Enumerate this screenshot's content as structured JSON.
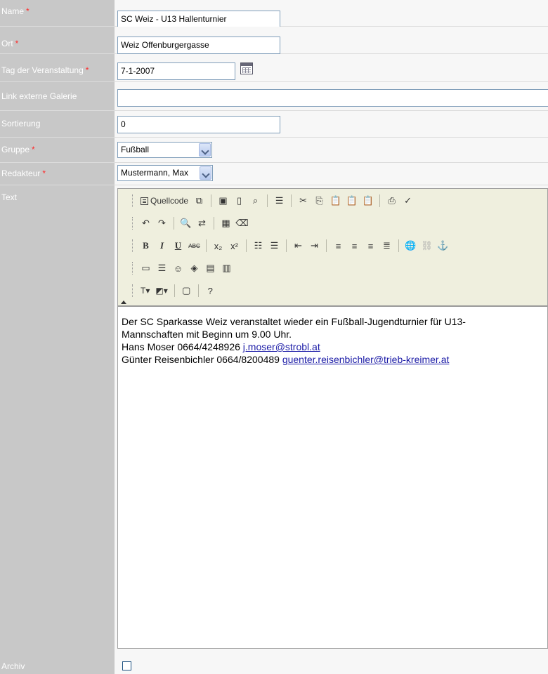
{
  "form": {
    "name": {
      "label": "Name",
      "required": "*",
      "value": "SC Weiz - U13 Hallenturnier"
    },
    "ort": {
      "label": "Ort",
      "required": "*",
      "value": "Weiz Offenburgergasse"
    },
    "tag": {
      "label": "Tag der Veranstaltung",
      "required": "*",
      "value": "7-1-2007"
    },
    "link": {
      "label": "Link externe Galerie",
      "value": ""
    },
    "sortierung": {
      "label": "Sortierung",
      "value": "0"
    },
    "gruppe": {
      "label": "Gruppe",
      "required": "*",
      "selected": "Fußball"
    },
    "redakteur": {
      "label": "Redakteur",
      "required": "*",
      "selected": "Mustermann, Max"
    },
    "text": {
      "label": "Text"
    },
    "archiv": {
      "label": "Archiv",
      "checked": false
    }
  },
  "editor": {
    "toolbar": {
      "source_label": "Quellcode",
      "bold": "B",
      "italic": "I",
      "underline": "U",
      "strike": "ABC"
    },
    "content": {
      "line1": "Der SC Sparkasse Weiz veranstaltet wieder ein Fußball-Jugendturnier für U13-",
      "line2": "Mannschaften mit Beginn um 9.00 Uhr.",
      "line3_prefix": "Hans Moser 0664/4248926 ",
      "line3_link": "j.moser@strobl.at",
      "line4_prefix": "Günter Reisenbichler 0664/8200489 ",
      "line4_link": "guenter.reisenbichler@trieb-kreimer.at"
    }
  },
  "colors": {
    "label_bg": "#c8c8c8",
    "required_star": "#ff2a2a",
    "toolbar_bg": "#efefde",
    "link": "#1a1aa6"
  }
}
